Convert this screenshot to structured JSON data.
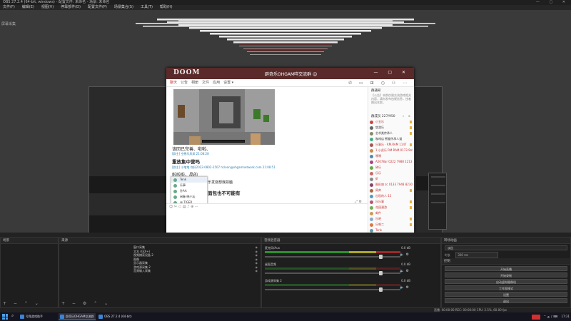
{
  "obs": {
    "title": "OBS 27.2.4 (64-bit, windows) - 配置文件: 未命名 - 场景: 未命名",
    "menu": [
      "文件(F)",
      "编辑(E)",
      "视图(V)",
      "停靠部件(D)",
      "配置文件(P)",
      "场景集合(S)",
      "工具(T)",
      "帮助(H)"
    ],
    "scene_tag": "屏幕采集",
    "docks": {
      "scenes": "场景",
      "sources": "来源",
      "mixer": "音频混音器",
      "transitions": "转场动画",
      "controls": "控制"
    },
    "source_items": [
      "窗口采集",
      "文本 (GDI+)",
      "视频捕获设备 2",
      "图像",
      "显示器采集",
      "游戏源采集 2",
      "音频输入采集"
    ],
    "mixer_tracks": [
      {
        "name": "麦克风/Aux",
        "db": "0.0 dB"
      },
      {
        "name": "桌面音频",
        "db": "0.0 dB"
      },
      {
        "name": "游戏源采集 2",
        "db": "0.0 dB"
      }
    ],
    "transition": {
      "type": "淡出",
      "duration_label": "时长",
      "duration": "300 ms"
    },
    "controls": [
      "开始直播",
      "开始录制",
      "启动虚拟摄像机",
      "工作室模式",
      "设置",
      "退出"
    ],
    "status": {
      "left": "",
      "right": "直播: 00:00:00    REC: 00:00:00    CPU: 2.5%, 60.00 fps"
    }
  },
  "qq": {
    "logo": "DOOM",
    "group_title": "辟奇乐OHGAM咩交流群 ☺",
    "tabs": [
      "聊天",
      "公告",
      "相册",
      "文件",
      "应用",
      "设置 ▾"
    ],
    "messages": {
      "m1": "该回已完善、啦啦、",
      "meta1": "[群主] 空想乐风采  21:08:28",
      "m2": "重放集中营吗",
      "meta2": "[群主] 小笔笔  你好2022-0802-2507  hclean@ohgamnetwork.com  21:08:51",
      "m3": "啦啦啦、晶的",
      "m4_tail": "乐发烧想我扣脑",
      "m5_tail": "面包也不可能有"
    },
    "at_popup": [
      "Tenk",
      "乐事",
      "孙AA",
      "闲春-晓小坛",
      "@ TIGER"
    ],
    "input_tools": "☺ ✂ ▭ ▤ ♪ ⊕ ⋯",
    "btn_close": "关闭(C)",
    "btn_send": "发送(S) ▾",
    "side": {
      "announcement_title": "群通知",
      "announcement_text": "【公告】本群仅限交流游戏相关内容，请勿发布违规信息，违者踢出本群。",
      "members_header": "群成员 227/950",
      "members": [
        {
          "name": "小丑乐",
          "color": "#c33",
          "badge": true
        },
        {
          "name": "悠游乐",
          "color": "#333",
          "badge": true
        },
        {
          "name": "艺术类传承人",
          "color": "#333",
          "badge": true
        },
        {
          "name": "咖啡店 熊猫传承人道",
          "color": "#333",
          "badge": false
        },
        {
          "name": "乐事乐 · RM.RAM 1147",
          "color": "#c33",
          "badge": true
        },
        {
          "name": "1 小虎乐 RM.RAM 0173.9m",
          "color": "#c33",
          "badge": false
        },
        {
          "name": "嘿嘿",
          "color": "#c33",
          "badge": false
        },
        {
          "name": "A2678ar 0222 7988 1213",
          "color": "#c33",
          "badge": false
        },
        {
          "name": "钟乐",
          "color": "#c33",
          "badge": false
        },
        {
          "name": "乐乐",
          "color": "#c33",
          "badge": false
        },
        {
          "name": "虾",
          "color": "#c33",
          "badge": false
        },
        {
          "name": "图形旅 zc 0133 7948 8230",
          "color": "#c33",
          "badge": false
        },
        {
          "name": "周帅",
          "color": "#c33",
          "badge": true
        },
        {
          "name": "出现的人·12",
          "color": "#c33",
          "badge": false
        },
        {
          "name": "乐乐事",
          "color": "#c33",
          "badge": true
        },
        {
          "name": "花园漫游",
          "color": "#c33",
          "badge": true
        },
        {
          "name": "邮件",
          "color": "#c33",
          "badge": false
        },
        {
          "name": "乐吧",
          "color": "#c33",
          "badge": true
        },
        {
          "name": "乐吧二",
          "color": "#c33",
          "badge": true
        },
        {
          "name": "Tenk",
          "color": "#c33",
          "badge": false
        },
        {
          "name": "Rmx",
          "color": "#c33",
          "badge": false
        },
        {
          "name": "游玩派·",
          "color": "#c33",
          "badge": true
        },
        {
          "name": "乐",
          "color": "#c33",
          "badge": false
        }
      ]
    }
  },
  "taskbar": {
    "items": [
      "号角游戏助手",
      "辟奇乐OHGAM交流群",
      "OBS 27.2.4 (64-bit)"
    ],
    "tray_time": "17:31",
    "tray_date": "2022/08/02"
  }
}
